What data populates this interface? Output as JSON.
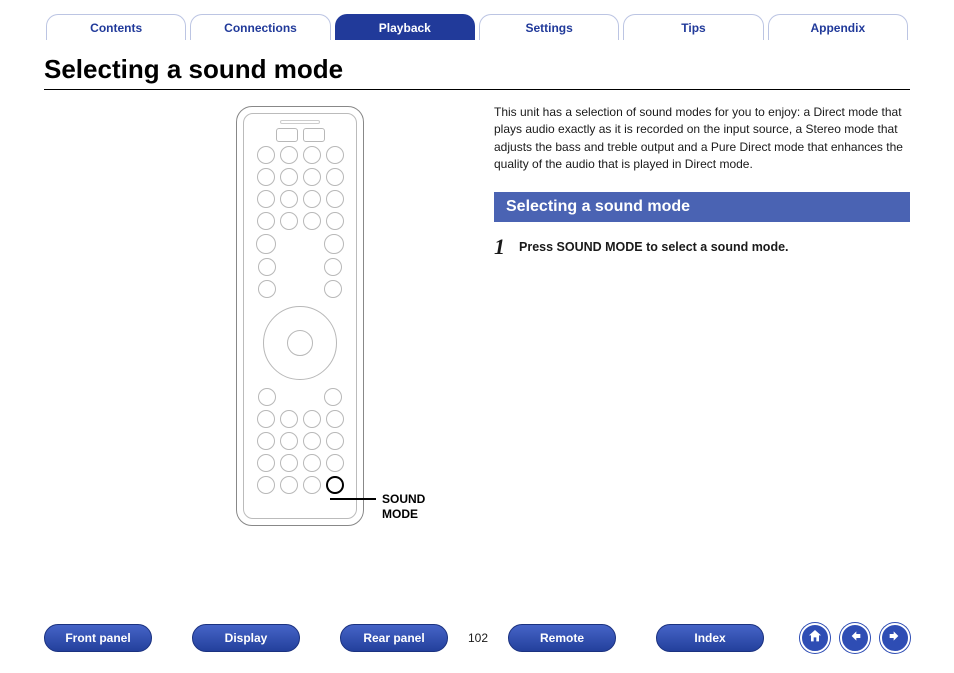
{
  "topNav": {
    "tabs": [
      {
        "label": "Contents"
      },
      {
        "label": "Connections"
      },
      {
        "label": "Playback"
      },
      {
        "label": "Settings"
      },
      {
        "label": "Tips"
      },
      {
        "label": "Appendix"
      }
    ],
    "activeIndex": 2
  },
  "page": {
    "title": "Selecting a sound mode",
    "intro": "This unit has a selection of sound modes for you to enjoy: a Direct mode that plays audio exactly as it is recorded on the input source, a Stereo mode that adjusts the bass and treble output and a Pure Direct mode that enhances the quality of the audio that is played in Direct mode.",
    "sectionBar": "Selecting a sound mode",
    "step": {
      "num": "1",
      "text": "Press SOUND MODE to select a sound mode."
    },
    "calloutL1": "SOUND",
    "calloutL2": "MODE"
  },
  "bottomNav": {
    "frontPanel": "Front panel",
    "display": "Display",
    "rearPanel": "Rear panel",
    "remote": "Remote",
    "index": "Index",
    "pageNumber": "102"
  }
}
